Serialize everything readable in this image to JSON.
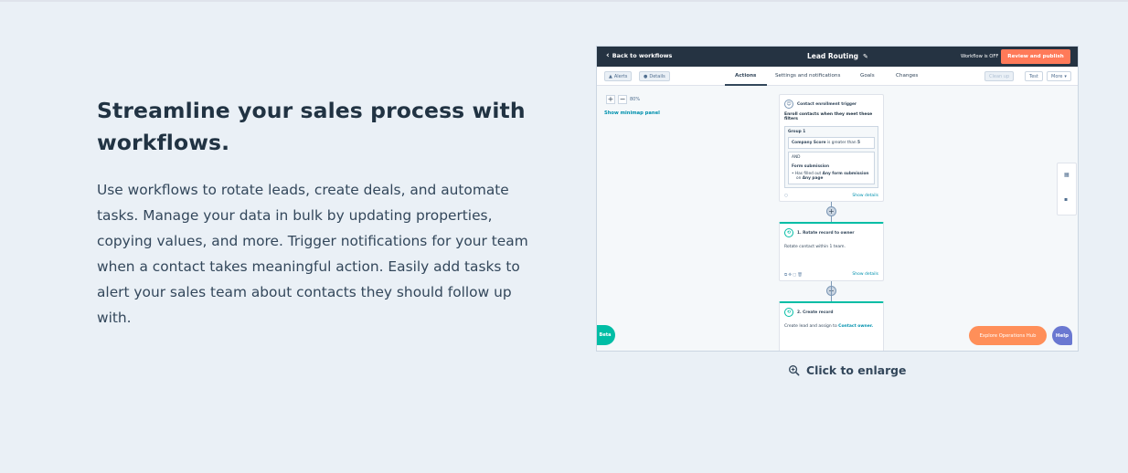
{
  "section": {
    "heading": "Streamline your sales process with workflows.",
    "body": "Use workflows to rotate leads, create deals, and automate tasks. Manage your data in bulk by updating properties, copying values, and more. Trigger notifications for your team when a contact takes meaningful action. Easily add tasks to alert your sales team about contacts they should follow up with."
  },
  "preview": {
    "back_label": "Back to workflows",
    "title": "Lead Routing",
    "status": "Workflow is OFF",
    "publish_label": "Review and publish",
    "toolbar": {
      "alerts": "Alerts",
      "details": "Details",
      "cleanup": "Clean up",
      "test": "Test",
      "more": "More"
    },
    "tabs": [
      "Actions",
      "Settings and notifications",
      "Goals",
      "Changes"
    ],
    "zoom": "80%",
    "minimap_label": "Show minimap panel",
    "trigger": {
      "header": "Contact enrollment trigger",
      "subtitle": "Enroll contacts when they meet these filters",
      "group_title": "Group 1",
      "filter_prop": "Company Score",
      "filter_op": "is greater than",
      "filter_val": "5",
      "and_label": "AND",
      "form_title": "Form submission",
      "form_line_1a": "Has filled out",
      "form_line_1b": "Any form submission",
      "form_line_2a": "on",
      "form_line_2b": "Any page",
      "show_details": "Show details"
    },
    "action1": {
      "header": "1. Rotate record to owner",
      "body": "Rotate contact within 1 team.",
      "show_details": "Show details"
    },
    "action2": {
      "header": "2. Create record",
      "body_prefix": "Create lead and assign to",
      "body_link": "Contact owner."
    },
    "beta_label": "Beta",
    "explore_label": "Explore Operations Hub",
    "help_label": "Help"
  },
  "enlarge_label": "Click to enlarge",
  "colors": {
    "page_bg": "#eaf0f6",
    "header_bg": "#253342",
    "publish": "#ff7a59",
    "teal": "#00bda5",
    "help": "#6a78d1"
  }
}
